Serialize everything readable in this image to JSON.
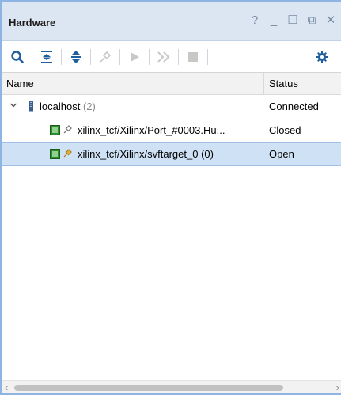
{
  "panel": {
    "title": "Hardware",
    "window_controls": {
      "help_glyph": "?",
      "minimize_glyph": "_",
      "maximize_glyph": "☐",
      "float_glyph": "⧉",
      "close_glyph": "✕"
    }
  },
  "toolbar": {
    "buttons": [
      {
        "icon": "search-icon",
        "enabled": true
      },
      {
        "icon": "collapse-all-icon",
        "enabled": true
      },
      {
        "icon": "expand-all-icon",
        "enabled": true
      },
      {
        "icon": "auto-connect-icon",
        "enabled": false
      },
      {
        "icon": "run-icon",
        "enabled": false
      },
      {
        "icon": "fast-forward-icon",
        "enabled": false
      },
      {
        "icon": "stop-icon",
        "enabled": false
      },
      {
        "icon": "gear-icon",
        "enabled": true
      }
    ],
    "accent_color": "#1f5f9e",
    "disabled_color": "#c8c8c8"
  },
  "table": {
    "columns": {
      "name": "Name",
      "status": "Status"
    },
    "rows": [
      {
        "label": "localhost",
        "count": "(2)",
        "status": "Connected",
        "expanded": true,
        "icon": "server-icon"
      },
      {
        "label": "xilinx_tcf/Xilinx/Port_#0003.Hu...",
        "status": "Closed",
        "icon": "chip-icon",
        "link_icon": "link-icon"
      },
      {
        "label": "xilinx_tcf/Xilinx/svftarget_0 (0)",
        "status": "Open",
        "icon": "chip-icon",
        "link_icon": "link-icon",
        "selected": true
      }
    ]
  },
  "colors": {
    "titlebar_bg": "#dce6f2",
    "selection_bg": "#cfe2f5",
    "frame_border": "#8db4e2"
  },
  "scrollbar": {
    "left_glyph": "‹",
    "right_glyph": "›"
  }
}
